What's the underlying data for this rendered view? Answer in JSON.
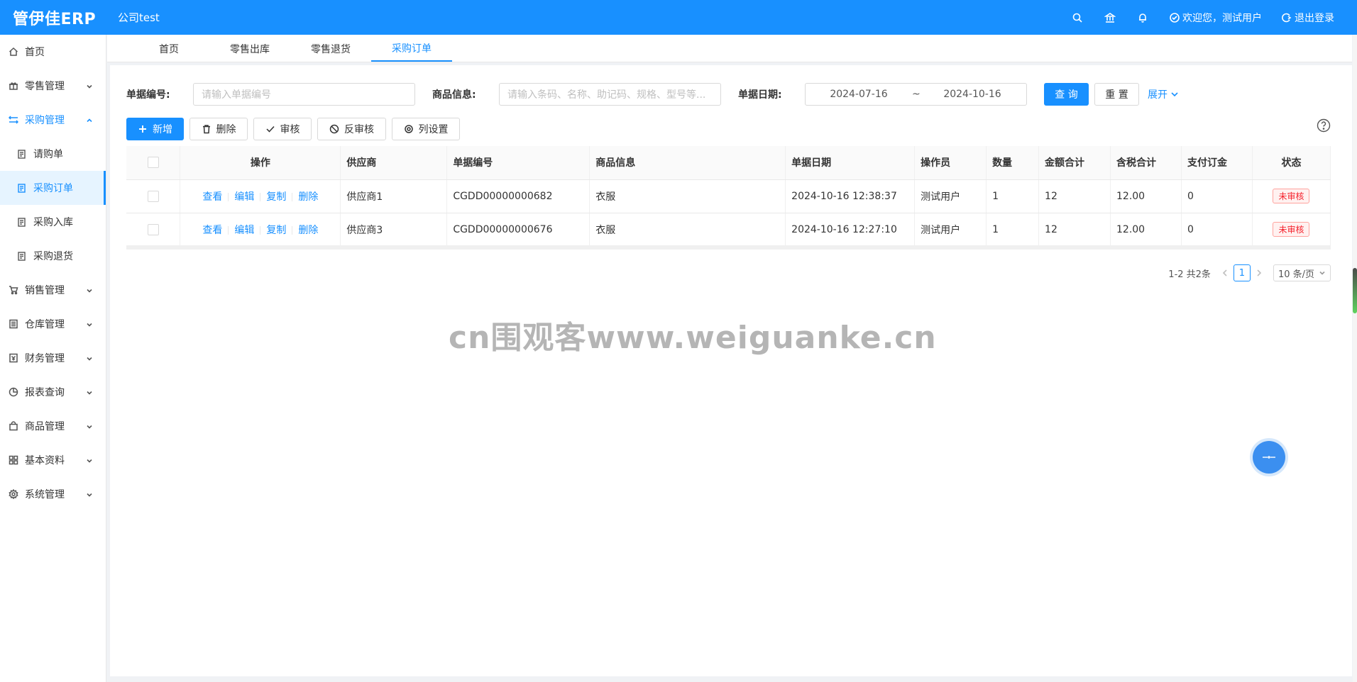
{
  "header": {
    "logo": "管伊佳ERP",
    "company": "公司test",
    "welcome": "欢迎您，测试用户",
    "logout": "退出登录"
  },
  "sidebar": {
    "items": [
      {
        "label": "首页",
        "icon": "home-icon"
      },
      {
        "label": "零售管理",
        "icon": "gift-icon"
      },
      {
        "label": "采购管理",
        "icon": "swap-icon"
      },
      {
        "label": "销售管理",
        "icon": "cart-icon"
      },
      {
        "label": "仓库管理",
        "icon": "warehouse-icon"
      },
      {
        "label": "财务管理",
        "icon": "finance-icon"
      },
      {
        "label": "报表查询",
        "icon": "pie-chart-icon"
      },
      {
        "label": "商品管理",
        "icon": "shopping-icon"
      },
      {
        "label": "基本资料",
        "icon": "appstore-icon"
      },
      {
        "label": "系统管理",
        "icon": "setting-icon"
      }
    ],
    "purchase_sub": [
      {
        "label": "请购单"
      },
      {
        "label": "采购订单"
      },
      {
        "label": "采购入库"
      },
      {
        "label": "采购退货"
      }
    ]
  },
  "tabs": [
    {
      "label": "首页"
    },
    {
      "label": "零售出库"
    },
    {
      "label": "零售退货"
    },
    {
      "label": "采购订单"
    }
  ],
  "filters": {
    "bill_no_label": "单据编号:",
    "bill_no_placeholder": "请输入单据编号",
    "goods_label": "商品信息:",
    "goods_placeholder": "请输入条码、名称、助记码、规格、型号等...",
    "date_label": "单据日期:",
    "date_start": "2024-07-16",
    "date_sep": "~",
    "date_end": "2024-10-16",
    "query": "查 询",
    "reset": "重 置",
    "expand": "展开"
  },
  "toolbar": {
    "add": "新增",
    "delete": "删除",
    "audit": "审核",
    "unaudit": "反审核",
    "columns": "列设置"
  },
  "table": {
    "headers": [
      "操作",
      "供应商",
      "单据编号",
      "商品信息",
      "单据日期",
      "操作员",
      "数量",
      "金额合计",
      "含税合计",
      "支付订金",
      "状态"
    ],
    "actions": [
      "查看",
      "编辑",
      "复制",
      "删除"
    ],
    "rows": [
      {
        "supplier": "供应商1",
        "bill_no": "CGDD00000000682",
        "goods": "衣服",
        "date": "2024-10-16 12:38:37",
        "operator": "测试用户",
        "qty": "1",
        "amount": "12",
        "tax_total": "12.00",
        "deposit": "0",
        "status": "未审核"
      },
      {
        "supplier": "供应商3",
        "bill_no": "CGDD00000000676",
        "goods": "衣服",
        "date": "2024-10-16 12:27:10",
        "operator": "测试用户",
        "qty": "1",
        "amount": "12",
        "tax_total": "12.00",
        "deposit": "0",
        "status": "未审核"
      }
    ]
  },
  "pagination": {
    "summary": "1-2 共2条",
    "current": "1",
    "page_size": "10 条/页"
  },
  "watermark": "cn围观客www.weiguanke.cn",
  "colors": {
    "primary": "#1890ff",
    "status_red": "#f5222d"
  }
}
